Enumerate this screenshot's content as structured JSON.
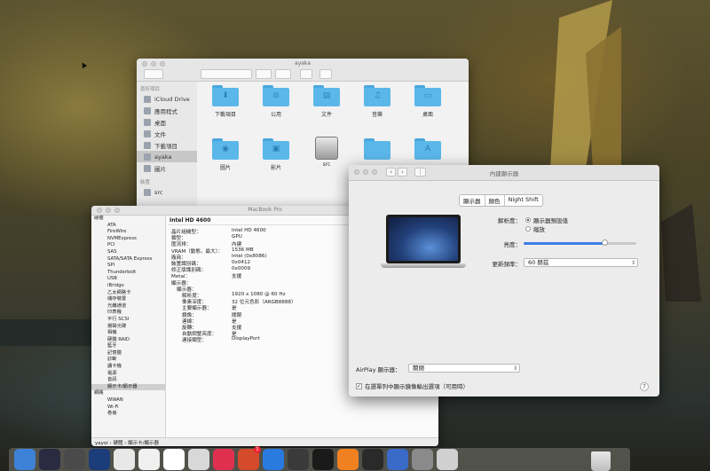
{
  "finder": {
    "title": "ayaka",
    "sidebar_heads": [
      "喜好項目",
      "裝置"
    ],
    "sidebar_items": [
      "iCloud Drive",
      "應用程式",
      "桌面",
      "文件",
      "下載項目",
      "ayaka",
      "圖片"
    ],
    "device_item": "src",
    "items": [
      "下載項目",
      "公用",
      "文件",
      "音樂",
      "桌面",
      "圖片",
      "影片",
      "src",
      "",
      ""
    ]
  },
  "sysinfo": {
    "title": "MacBook Pro",
    "tree": [
      {
        "label": "硬體",
        "cat": true
      },
      {
        "label": "ATA"
      },
      {
        "label": "FireWire"
      },
      {
        "label": "NVMExpress"
      },
      {
        "label": "PCI"
      },
      {
        "label": "SAS"
      },
      {
        "label": "SATA/SATA Express"
      },
      {
        "label": "SPI"
      },
      {
        "label": "Thunderbolt"
      },
      {
        "label": "USB"
      },
      {
        "label": "iBridge"
      },
      {
        "label": "乙太網路卡"
      },
      {
        "label": "儲存裝置"
      },
      {
        "label": "光纖通道"
      },
      {
        "label": "印表機"
      },
      {
        "label": "平行 SCSI"
      },
      {
        "label": "揚聲光碟"
      },
      {
        "label": "相機"
      },
      {
        "label": "硬體 RAID"
      },
      {
        "label": "藍牙"
      },
      {
        "label": "記憶體"
      },
      {
        "label": "診斷"
      },
      {
        "label": "讀卡機"
      },
      {
        "label": "電源"
      },
      {
        "label": "音訊"
      },
      {
        "label": "顯示卡/顯示器",
        "sel": true
      },
      {
        "label": "網路",
        "cat": true
      },
      {
        "label": "WWAN"
      },
      {
        "label": "Wi-Fi"
      },
      {
        "label": "卷冊"
      }
    ],
    "heading": "Intel HD 4600",
    "details": [
      {
        "k": "晶片組機型：",
        "v": "Intel HD 4600"
      },
      {
        "k": "類型：",
        "v": "GPU"
      },
      {
        "k": "匯流排：",
        "v": "內建"
      },
      {
        "k": "VRAM（動態，最大）：",
        "v": "1536 MB"
      },
      {
        "k": "廠商：",
        "v": "Intel (0x8086)"
      },
      {
        "k": "裝置識別碼：",
        "v": "0x0412"
      },
      {
        "k": "修正版識別碼：",
        "v": "0x0009"
      },
      {
        "k": "Metal：",
        "v": "支援"
      },
      {
        "k": "顯示器：",
        "v": ""
      },
      {
        "k": "顯示器：",
        "v": ""
      },
      {
        "k": "解析度：",
        "v": "1920 x 1080 @ 60 Hz"
      },
      {
        "k": "像素深度：",
        "v": "32 位元色彩（ARGB8888）"
      },
      {
        "k": "主要顯示器：",
        "v": "是"
      },
      {
        "k": "鏡像：",
        "v": "關閉"
      },
      {
        "k": "連線：",
        "v": "是"
      },
      {
        "k": "旋轉：",
        "v": "支援"
      },
      {
        "k": "自動調整亮度：",
        "v": "是"
      },
      {
        "k": "連接類型：",
        "v": "DisplayPort"
      }
    ],
    "status_path": "yayoi › 硬體 › 顯示卡/顯示器"
  },
  "prefs": {
    "title": "內建顯示器",
    "tabs": [
      "顯示器",
      "顏色",
      "Night Shift"
    ],
    "resolution_label": "解析度：",
    "resolution_options": [
      "顯示器預設值",
      "縮放"
    ],
    "brightness_label": "亮度：",
    "brightness_level": 0.72,
    "refresh_label": "更新頻率：",
    "refresh_value": "60 赫茲",
    "airplay_label": "AirPlay 顯示器：",
    "airplay_value": "關閉",
    "checkbox_label": "在選單列中顯示鏡像輸出選項（可用時）",
    "help": "?"
  },
  "dock": {
    "badge": "1",
    "colors": [
      "#3d82d6",
      "#2a2a40",
      "#4a4a4a",
      "#1b3d7a",
      "#e8e8e8",
      "#f0f0f0",
      "#ffffff",
      "#d8d8d8",
      "#e03050",
      "#d44a2a",
      "#2a7ae0",
      "#3a3a3a",
      "#1a1a1a",
      "#f08020",
      "#2a2a2a",
      "#3a6ac8",
      "#8a8a8a",
      "#d0d0d0"
    ]
  },
  "colors": {
    "accent": "#3d7ee6",
    "folder": "#5bb7ea"
  }
}
